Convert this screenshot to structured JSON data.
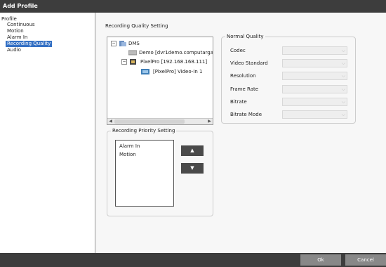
{
  "window": {
    "title": "Add Profile"
  },
  "nav": {
    "root": "Profile",
    "items": [
      {
        "label": "Continuous"
      },
      {
        "label": "Motion"
      },
      {
        "label": "Alarm In"
      },
      {
        "label": "Recording Quality",
        "selected": true
      },
      {
        "label": "Audio"
      }
    ]
  },
  "quality": {
    "title": "Recording Quality Setting",
    "tree": {
      "root": "DMS",
      "demo": "Demo [dvr1demo.computarganz.con",
      "pixelpro": "PixelPro [192.168.168.111]",
      "channel": "[PixelPro] Video-In 1"
    },
    "normal": {
      "title": "Normal Quality",
      "fields": [
        {
          "label": "Codec",
          "value": ""
        },
        {
          "label": "Video Standard",
          "value": ""
        },
        {
          "label": "Resolution",
          "value": ""
        },
        {
          "label": "Frame Rate",
          "value": ""
        },
        {
          "label": "Bitrate",
          "value": ""
        },
        {
          "label": "Bitrate Mode",
          "value": ""
        }
      ]
    }
  },
  "priority": {
    "title": "Recording Priority Setting",
    "items": [
      "Alarm In",
      "Motion"
    ],
    "up": "▲",
    "down": "▼"
  },
  "footer": {
    "ok": "Ok",
    "cancel": "Cancel"
  },
  "colors": {
    "titlebar": "#3d3d3d",
    "selection": "#3470c4"
  }
}
